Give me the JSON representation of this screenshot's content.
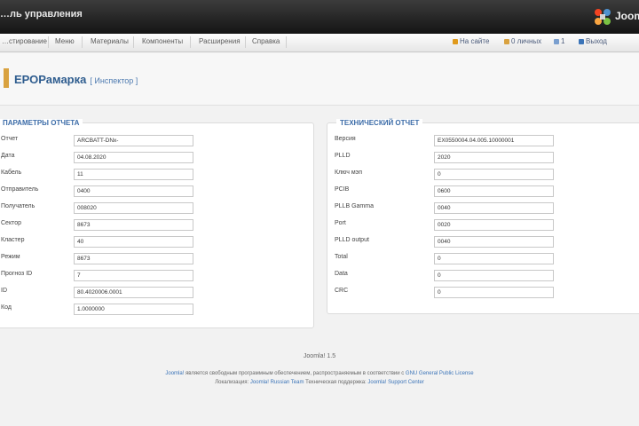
{
  "header": {
    "title": "…ль управления",
    "brand": "Joom…"
  },
  "menu": {
    "items": [
      "…стирование",
      "Меню",
      "Материалы",
      "Компоненты",
      "Расширения",
      "Справка"
    ]
  },
  "status": {
    "items": [
      {
        "label": "На сайте",
        "icon": "eye-icon",
        "color": "#e09a1c"
      },
      {
        "label": "0 личных",
        "icon": "envelope-icon",
        "color": "#d9a240"
      },
      {
        "label": "1",
        "icon": "user-icon",
        "color": "#7a9fcf"
      },
      {
        "label": "Выход",
        "icon": "logout-icon",
        "color": "#3b74b8"
      }
    ]
  },
  "page": {
    "title": "ЕРОРамарка",
    "subtitle": "[ Инспектор ]"
  },
  "left_panel": {
    "legend": "ПАРАМЕТРЫ ОТЧЕТА",
    "rows": [
      {
        "label": "Отчет",
        "value": "ARCBATT-DNx-"
      },
      {
        "label": "Дата",
        "value": "04.08.2020"
      },
      {
        "label": "Кабель",
        "value": "11"
      },
      {
        "label": "Отправитель",
        "value": "0400"
      },
      {
        "label": "Получатель",
        "value": "008020"
      },
      {
        "label": "Сектор",
        "value": "8673"
      },
      {
        "label": "Кластер",
        "value": "40"
      },
      {
        "label": "Режим",
        "value": "8673"
      },
      {
        "label": "Прогноз ID",
        "value": "7"
      },
      {
        "label": "ID",
        "value": "80.4020006.0001"
      },
      {
        "label": "Код",
        "value": "1.0000000"
      }
    ]
  },
  "right_panel": {
    "legend": "ТЕХНИЧЕСКИЙ ОТЧЕТ",
    "rows": [
      {
        "label": "Версия",
        "value": "ЕХ0550004.04.005.10000001"
      },
      {
        "label": "PLLD",
        "value": "2020"
      },
      {
        "label": "Ключ мэп",
        "value": "0"
      },
      {
        "label": "PCIB",
        "value": "0600"
      },
      {
        "label": "PLLB Gamma",
        "value": "0040"
      },
      {
        "label": "Port",
        "value": "0020"
      },
      {
        "label": "PLLD output",
        "value": "0040"
      },
      {
        "label": "Total",
        "value": "0"
      },
      {
        "label": "Data",
        "value": "0"
      },
      {
        "label": "CRC",
        "value": "0"
      }
    ]
  },
  "footer": {
    "version": "Joomla! 1.5",
    "line1_link": "Joomla!",
    "line1_text": " является свободным программным обеспечением, распространяемым в соответствии с ",
    "line1_link2": "GNU General Public License",
    "line2_text": "Локализация: ",
    "line2_link": "Joomla! Russian Team",
    "line2_text2": "  Техническая поддержка: ",
    "line2_link2": "Joomla! Support Center"
  },
  "colors": {
    "accent": "#2f5d8f",
    "legend": "#3c6ca8",
    "header_bg": "#1e1e1e"
  }
}
